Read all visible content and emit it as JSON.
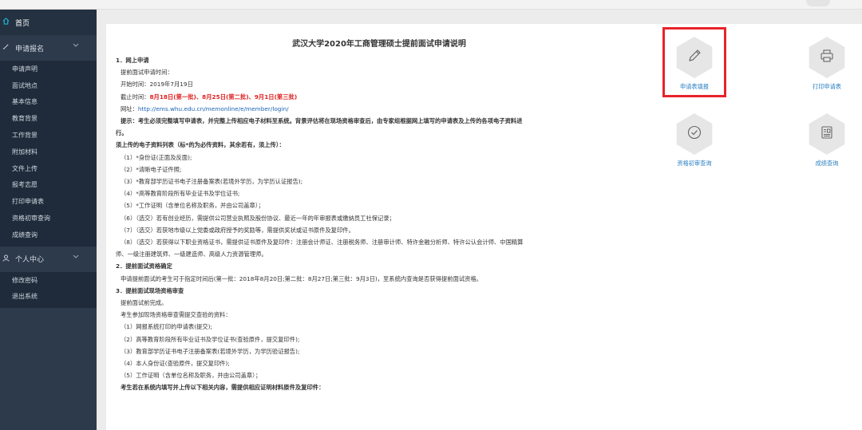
{
  "sidebar": {
    "home": "首页",
    "group_apply": {
      "label": "申请报名",
      "items": [
        "申请声明",
        "面试地点",
        "基本信息",
        "教育背景",
        "工作背景",
        "附加材料",
        "文件上传",
        "报考志愿",
        "打印申请表",
        "资格初审查询",
        "成绩查询"
      ]
    },
    "group_user": {
      "label": "个人中心",
      "items": [
        "修改密码",
        "退出系统"
      ]
    }
  },
  "doc": {
    "title": "武汉大学2020年工商管理硕士提前面试申请说明",
    "s1_head": "1．网上申请",
    "s1_time_label": "提前面试申请时间：",
    "s1_start": "开始时间：2019年7月19日",
    "s1_end_prefix": "截止时间：",
    "s1_end_dates": "8月18日(第一批)、8月25日(第二批)、9月1日(第三批)",
    "s1_url_prefix": "网址：",
    "s1_url": "http://ems.whu.edu.cn/memonline/e/member/login/",
    "s1_tip_1": "提示：考生必须完整填写申请表，并完整上传相应电子材料至系统。背景评估将在现场资格审查后，由专家组根据网上填写的申请表及上传的各项电子资料进",
    "s1_tip_2": "行。",
    "s1_list_head": "须上传的电子资料列表（标*的为必传资料，其余若有，须上传）：",
    "s1_items": [
      "（1）*身份证(正面及反面);",
      "（2）*清晰电子证件照;",
      "（3）*教育部学历证书电子注册备案表(若境外学历，为学历认证报告);",
      "（4）*高等教育阶段所有毕业证书及学位证书;",
      "（5）*工作证明（含单位名称及职务，并由公司盖章）；",
      "（6）（选交）若有创业经历，需提供公司营业执照及股份协议、最近一年的年审报表或缴纳员工社保记录；",
      "（7）（选交）若获地市级以上党委或政府授予的奖励等，需提供奖状或证书原件及复印件。",
      "（8）（选交）若获得以下职业资格证书，需提供证书原件及复印件：注册会计师证、注册税务师、注册审计师、特许金融分析师、特许公认会计师、中国精算"
    ],
    "s1_items_cont": "师、一级注册建筑师、一级建造师、高级人力资源管理师。",
    "s2_head": "2．提前面试资格确定",
    "s2_text": "申请提前面试的考生可于指定时间后(第一批：2018年8月20日;第二批：8月27日;第三批：9月3日)，至系统内查询是否获得提前面试资格。",
    "s3_head": "3．提前面试现场资格审查",
    "s3_line1": "提前面试前完成。",
    "s3_line2": "考生参加现场资格审查需提交查验的资料：",
    "s3_items": [
      "（1）网报系统打印的申请表(提交);",
      "（2）高等教育阶段所有毕业证书及学位证书(查验原件，提交复印件);",
      "（3）教育部学历证书电子注册备案表(若境外学历，为学历验证报告);",
      "（4）本人身份证(查验原件，提交复印件);",
      "（5）工作证明（含单位名称及职务，并由公司盖章）；"
    ],
    "s3_last": "考生若在系统内填写并上传以下相关内容，需提供相应证明材料原件及复印件："
  },
  "tiles": {
    "apply_form": {
      "label": "申请表填报",
      "icon": "pencil-icon"
    },
    "print_form": {
      "label": "打印申请表",
      "icon": "printer-icon"
    },
    "review_query": {
      "label": "资格初审查询",
      "icon": "check-circle-icon"
    },
    "score_query": {
      "label": "成绩查询",
      "icon": "id-card-icon"
    }
  },
  "colors": {
    "sidebar_bg": "#2d3a4b",
    "highlight": "#e8232a",
    "link": "#1a63b5",
    "tile_label": "#2b7fc0",
    "deadline_red": "#e02020"
  }
}
